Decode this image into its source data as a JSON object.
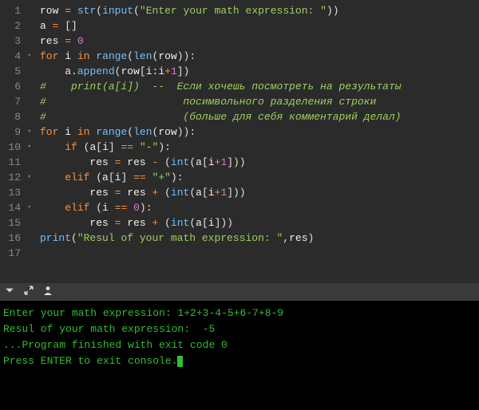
{
  "editor": {
    "line_count": 17,
    "code_tokens": [
      [
        [
          "var",
          "row"
        ],
        [
          "pun",
          " "
        ],
        [
          "op",
          "="
        ],
        [
          "pun",
          " "
        ],
        [
          "fn",
          "str"
        ],
        [
          "pun",
          "("
        ],
        [
          "fn",
          "input"
        ],
        [
          "pun",
          "("
        ],
        [
          "str",
          "\"Enter your math expression: \""
        ],
        [
          "pun",
          "))"
        ]
      ],
      [
        [
          "var",
          "a"
        ],
        [
          "pun",
          " "
        ],
        [
          "op",
          "="
        ],
        [
          "pun",
          " []"
        ]
      ],
      [
        [
          "var",
          "res"
        ],
        [
          "pun",
          " "
        ],
        [
          "op",
          "="
        ],
        [
          "pun",
          " "
        ],
        [
          "num",
          "0"
        ]
      ],
      [
        [
          "kw",
          "for"
        ],
        [
          "pun",
          " "
        ],
        [
          "var",
          "i"
        ],
        [
          "pun",
          " "
        ],
        [
          "kw",
          "in"
        ],
        [
          "pun",
          " "
        ],
        [
          "fn",
          "range"
        ],
        [
          "pun",
          "("
        ],
        [
          "fn",
          "len"
        ],
        [
          "pun",
          "("
        ],
        [
          "var",
          "row"
        ],
        [
          "pun",
          ")):"
        ]
      ],
      [
        [
          "pun",
          "    "
        ],
        [
          "var",
          "a"
        ],
        [
          "pun",
          "."
        ],
        [
          "fn",
          "append"
        ],
        [
          "pun",
          "("
        ],
        [
          "var",
          "row"
        ],
        [
          "pun",
          "["
        ],
        [
          "var",
          "i"
        ],
        [
          "pun",
          ":"
        ],
        [
          "var",
          "i"
        ],
        [
          "op",
          "+"
        ],
        [
          "num",
          "1"
        ],
        [
          "pun",
          "])"
        ]
      ],
      [
        [
          "cmt",
          "#    print(a[i])  --  Если хочешь посмотреть на результаты"
        ]
      ],
      [
        [
          "cmt",
          "#                      посимвольного разделения строки"
        ]
      ],
      [
        [
          "cmt",
          "#                      (больше для себя комментарий делал)"
        ]
      ],
      [
        [
          "kw",
          "for"
        ],
        [
          "pun",
          " "
        ],
        [
          "var",
          "i"
        ],
        [
          "pun",
          " "
        ],
        [
          "kw",
          "in"
        ],
        [
          "pun",
          " "
        ],
        [
          "fn",
          "range"
        ],
        [
          "pun",
          "("
        ],
        [
          "fn",
          "len"
        ],
        [
          "pun",
          "("
        ],
        [
          "var",
          "row"
        ],
        [
          "pun",
          ")):"
        ]
      ],
      [
        [
          "pun",
          "    "
        ],
        [
          "kw",
          "if"
        ],
        [
          "pun",
          " ("
        ],
        [
          "var",
          "a"
        ],
        [
          "pun",
          "["
        ],
        [
          "var",
          "i"
        ],
        [
          "pun",
          "] "
        ],
        [
          "op",
          "=="
        ],
        [
          "pun",
          " "
        ],
        [
          "str",
          "\"-\""
        ],
        [
          "pun",
          "):"
        ]
      ],
      [
        [
          "pun",
          "        "
        ],
        [
          "var",
          "res"
        ],
        [
          "pun",
          " "
        ],
        [
          "op",
          "="
        ],
        [
          "pun",
          " "
        ],
        [
          "var",
          "res"
        ],
        [
          "pun",
          " "
        ],
        [
          "op",
          "-"
        ],
        [
          "pun",
          " ("
        ],
        [
          "fn",
          "int"
        ],
        [
          "pun",
          "("
        ],
        [
          "var",
          "a"
        ],
        [
          "pun",
          "["
        ],
        [
          "var",
          "i"
        ],
        [
          "op",
          "+"
        ],
        [
          "num",
          "1"
        ],
        [
          "pun",
          "]))"
        ]
      ],
      [
        [
          "pun",
          "    "
        ],
        [
          "kw",
          "elif"
        ],
        [
          "pun",
          " ("
        ],
        [
          "var",
          "a"
        ],
        [
          "pun",
          "["
        ],
        [
          "var",
          "i"
        ],
        [
          "pun",
          "] "
        ],
        [
          "op",
          "=="
        ],
        [
          "pun",
          " "
        ],
        [
          "str",
          "\"+\""
        ],
        [
          "pun",
          "):"
        ]
      ],
      [
        [
          "pun",
          "        "
        ],
        [
          "var",
          "res"
        ],
        [
          "pun",
          " "
        ],
        [
          "op",
          "="
        ],
        [
          "pun",
          " "
        ],
        [
          "var",
          "res"
        ],
        [
          "pun",
          " "
        ],
        [
          "op",
          "+"
        ],
        [
          "pun",
          " ("
        ],
        [
          "fn",
          "int"
        ],
        [
          "pun",
          "("
        ],
        [
          "var",
          "a"
        ],
        [
          "pun",
          "["
        ],
        [
          "var",
          "i"
        ],
        [
          "op",
          "+"
        ],
        [
          "num",
          "1"
        ],
        [
          "pun",
          "]))"
        ]
      ],
      [
        [
          "pun",
          "    "
        ],
        [
          "kw",
          "elif"
        ],
        [
          "pun",
          " ("
        ],
        [
          "var",
          "i"
        ],
        [
          "pun",
          " "
        ],
        [
          "op",
          "=="
        ],
        [
          "pun",
          " "
        ],
        [
          "num",
          "0"
        ],
        [
          "pun",
          "):"
        ]
      ],
      [
        [
          "pun",
          "        "
        ],
        [
          "var",
          "res"
        ],
        [
          "pun",
          " "
        ],
        [
          "op",
          "="
        ],
        [
          "pun",
          " "
        ],
        [
          "var",
          "res"
        ],
        [
          "pun",
          " "
        ],
        [
          "op",
          "+"
        ],
        [
          "pun",
          " ("
        ],
        [
          "fn",
          "int"
        ],
        [
          "pun",
          "("
        ],
        [
          "var",
          "a"
        ],
        [
          "pun",
          "["
        ],
        [
          "var",
          "i"
        ],
        [
          "pun",
          "]))"
        ]
      ],
      [
        [
          "fn",
          "print"
        ],
        [
          "pun",
          "("
        ],
        [
          "str",
          "\"Resul of your math expression: \""
        ],
        [
          "pun",
          ","
        ],
        [
          "var",
          "res"
        ],
        [
          "pun",
          ")"
        ]
      ],
      []
    ],
    "fold_rows": [
      4,
      9,
      10,
      12,
      14
    ]
  },
  "console": {
    "lines": [
      "Enter your math expression: 1+2+3-4-5+6-7+8-9",
      "Resul of your math expression:  -5",
      "",
      "",
      "...Program finished with exit code 0",
      "Press ENTER to exit console."
    ]
  }
}
